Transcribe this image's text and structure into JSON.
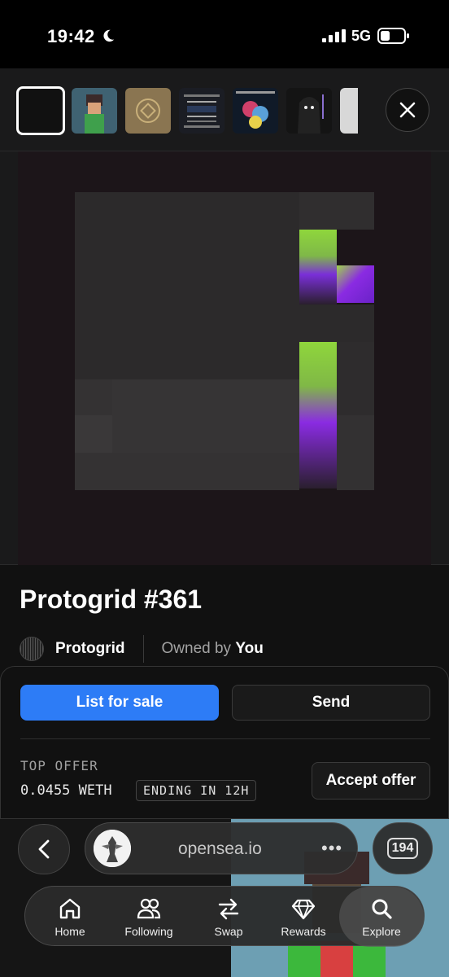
{
  "status_bar": {
    "time": "19:42",
    "network": "5G"
  },
  "thumb_strip": {
    "close_label": "close"
  },
  "nft": {
    "title": "Protogrid #361",
    "collection": "Protogrid",
    "owned_prefix": "Owned by",
    "owner": "You"
  },
  "actions": {
    "list_label": "List for sale",
    "send_label": "Send",
    "top_offer_label": "TOP OFFER",
    "top_offer_value": "0.0455 WETH",
    "ending_badge": "ENDING IN 12H",
    "accept_label": "Accept offer"
  },
  "browser": {
    "url": "opensea.io",
    "more": "•••",
    "tab_count": "194"
  },
  "tabbar": {
    "items": [
      {
        "label": "Home",
        "icon": "home-icon"
      },
      {
        "label": "Following",
        "icon": "people-icon"
      },
      {
        "label": "Swap",
        "icon": "swap-icon"
      },
      {
        "label": "Rewards",
        "icon": "diamond-icon"
      },
      {
        "label": "Explore",
        "icon": "search-icon"
      }
    ]
  },
  "colors": {
    "accent": "#2d7cf6",
    "green": "#8ed63a",
    "purple": "#8a2be2"
  }
}
